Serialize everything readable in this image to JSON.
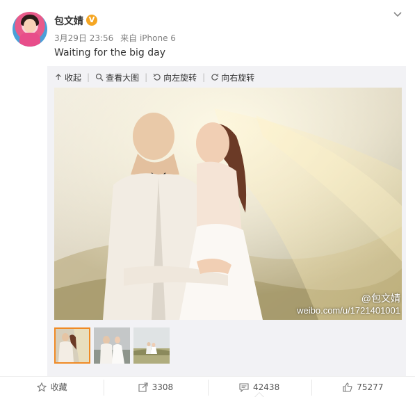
{
  "post": {
    "username": "包文婧",
    "verified_mark": "V",
    "date": "3月29日 23:56",
    "source": "来自 iPhone 6",
    "text": "Waiting for the big day"
  },
  "toolbar": {
    "collapse": "收起",
    "view_large": "查看大图",
    "rotate_left": "向左旋转",
    "rotate_right": "向右旋转"
  },
  "watermark": {
    "handle": "@包文婧",
    "url": "weibo.com/u/1721401001"
  },
  "thumbnails": {
    "count": 3,
    "selected_index": 0
  },
  "actions": {
    "favorite": "收藏",
    "repost_count": "3308",
    "comment_count": "42438",
    "like_count": "75277"
  },
  "colors": {
    "accent_orange": "#f08a24",
    "verified": "#f5a623"
  }
}
